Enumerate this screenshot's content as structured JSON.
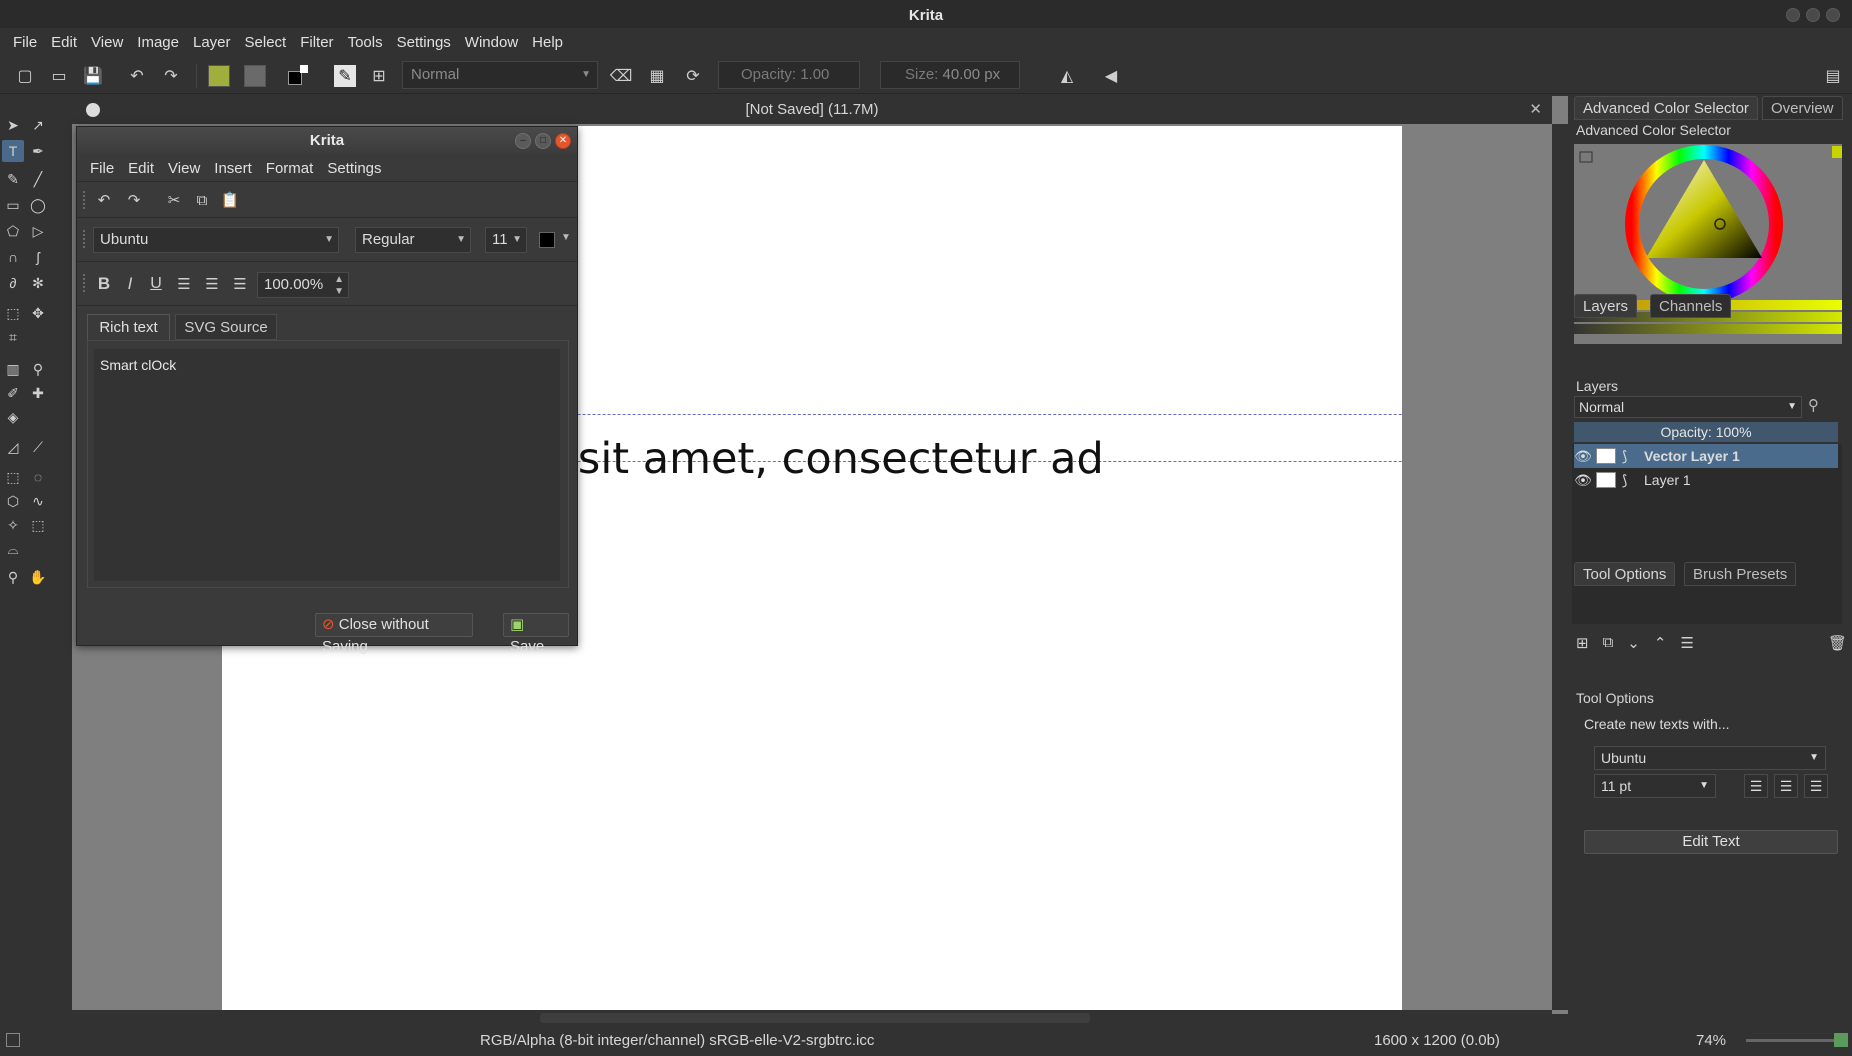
{
  "app": {
    "title": "Krita"
  },
  "menubar": {
    "items": [
      "File",
      "Edit",
      "View",
      "Image",
      "Layer",
      "Select",
      "Filter",
      "Tools",
      "Settings",
      "Window",
      "Help"
    ]
  },
  "toolbar": {
    "blend_mode": "Normal",
    "opacity_label": "Opacity:",
    "opacity_value": "1.00",
    "size_label": "Size:",
    "size_value": "40.00 px"
  },
  "document": {
    "title": "[Not Saved]  (11.7M)",
    "canvas_text": "Lorem ipsum dolor sit amet, consectetur ad"
  },
  "text_dialog": {
    "title": "Krita",
    "menu": [
      "File",
      "Edit",
      "View",
      "Insert",
      "Format",
      "Settings"
    ],
    "font_family": "Ubuntu",
    "font_style": "Regular",
    "font_size": "11",
    "line_height": "100.00%",
    "tabs": [
      "Rich text",
      "SVG Source"
    ],
    "editor_text": "Smart clOck",
    "close_without_saving": "Close without Saving",
    "save": "Save"
  },
  "dock": {
    "color_tabs": [
      "Advanced Color Selector",
      "Overview"
    ],
    "color_panel_title": "Advanced Color Selector",
    "layer_tabs": [
      "Layers",
      "Channels"
    ],
    "layers_title": "Layers",
    "layer_blend": "Normal",
    "layer_opacity": "Opacity:  100%",
    "layers": [
      {
        "name": "Vector Layer 1",
        "selected": true
      },
      {
        "name": "Layer 1",
        "selected": false
      }
    ],
    "options_tabs": [
      "Tool Options",
      "Brush Presets"
    ],
    "tool_options_title": "Tool Options",
    "create_text_label": "Create new texts with...",
    "font": "Ubuntu",
    "font_size": "11 pt",
    "edit_text": "Edit Text"
  },
  "status": {
    "color_info": "RGB/Alpha (8-bit integer/channel)  sRGB-elle-V2-srgbtrc.icc",
    "dimensions": "1600 x 1200 (0.0b)",
    "zoom": "74%"
  },
  "colors": {
    "background": "#323232",
    "selection": "#4a6b8c",
    "canvas": "#ffffff",
    "close_button": "#e4572e"
  }
}
